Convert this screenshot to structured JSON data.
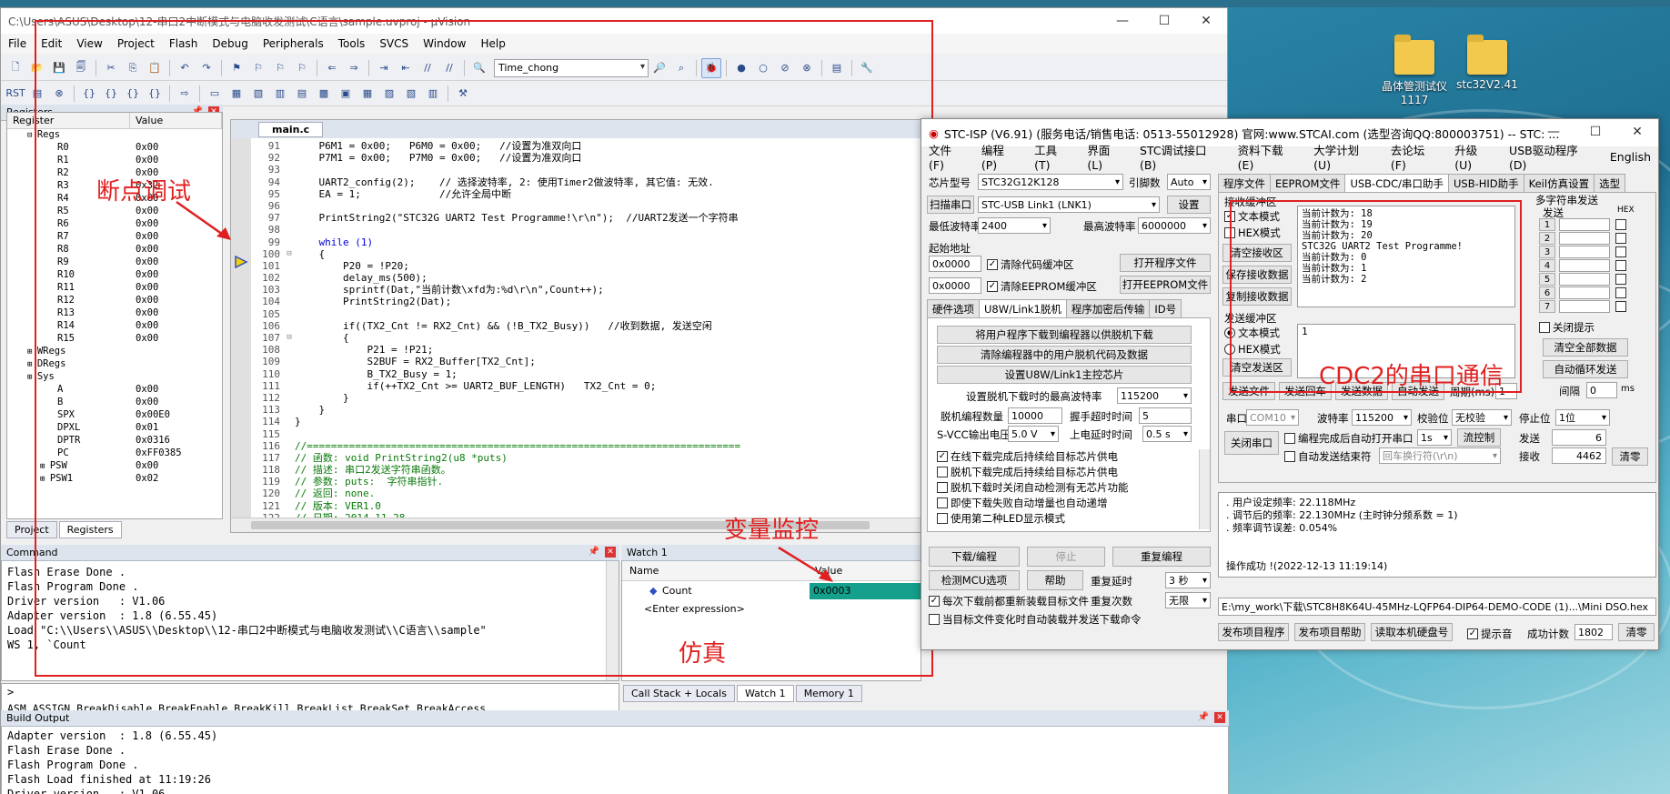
{
  "keil": {
    "title": "C:\\Users\\ASUS\\Desktop\\12-串口2中断模式与电脑收发测试\\C语言\\sample.uvproj - µVision",
    "menu": [
      "File",
      "Edit",
      "View",
      "Project",
      "Flash",
      "Debug",
      "Peripherals",
      "Tools",
      "SVCS",
      "Window",
      "Help"
    ],
    "target_combo": "Time_chong",
    "registers": {
      "title": "Registers",
      "col_register": "Register",
      "col_value": "Value",
      "rows": [
        {
          "name": "Regs",
          "value": "",
          "group": true
        },
        {
          "name": "R0",
          "value": "0x00"
        },
        {
          "name": "R1",
          "value": "0x00"
        },
        {
          "name": "R2",
          "value": "0x00"
        },
        {
          "name": "R3",
          "value": "0x32"
        },
        {
          "name": "R4",
          "value": "0x00"
        },
        {
          "name": "R5",
          "value": "0x00"
        },
        {
          "name": "R6",
          "value": "0x00"
        },
        {
          "name": "R7",
          "value": "0x00"
        },
        {
          "name": "R8",
          "value": "0x00"
        },
        {
          "name": "R9",
          "value": "0x00"
        },
        {
          "name": "R10",
          "value": "0x00"
        },
        {
          "name": "R11",
          "value": "0x00"
        },
        {
          "name": "R12",
          "value": "0x00"
        },
        {
          "name": "R13",
          "value": "0x00"
        },
        {
          "name": "R14",
          "value": "0x00"
        },
        {
          "name": "R15",
          "value": "0x00"
        },
        {
          "name": "WRegs",
          "value": "",
          "group": true
        },
        {
          "name": "DRegs",
          "value": "",
          "group": true
        },
        {
          "name": "Sys",
          "value": "",
          "group": true
        },
        {
          "name": "A",
          "value": "0x00"
        },
        {
          "name": "B",
          "value": "0x00"
        },
        {
          "name": "SPX",
          "value": "0x00E0"
        },
        {
          "name": "DPXL",
          "value": "0x01"
        },
        {
          "name": "DPTR",
          "value": "0x0316"
        },
        {
          "name": "PC",
          "value": "0xFF0385"
        },
        {
          "name": "PSW",
          "value": "0x00",
          "sub": true
        },
        {
          "name": "PSW1",
          "value": "0x02",
          "sub": true
        }
      ],
      "tabs": [
        "Project",
        "Registers"
      ]
    },
    "editor": {
      "tab": "main.c",
      "lines": [
        {
          "no": "91",
          "text": "    P6M1 = 0x00;   P6M0 = 0x00;   //设置为准双向口",
          "cls": "code"
        },
        {
          "no": "92",
          "text": "    P7M1 = 0x00;   P7M0 = 0x00;   //设置为准双向口",
          "cls": "code"
        },
        {
          "no": "93",
          "text": "",
          "cls": "code"
        },
        {
          "no": "94",
          "text": "    UART2_config(2);    // 选择波特率, 2: 使用Timer2做波特率, 其它值: 无效.",
          "cls": "code"
        },
        {
          "no": "95",
          "text": "    EA = 1;             //允许全局中断",
          "cls": "code"
        },
        {
          "no": "96",
          "text": "",
          "cls": "code"
        },
        {
          "no": "97",
          "text": "    PrintString2(\"STC32G UART2 Test Programme!\\r\\n\");  //UART2发送一个字符串",
          "cls": "code"
        },
        {
          "no": "98",
          "text": "",
          "cls": "code"
        },
        {
          "no": "99",
          "text": "    while (1)",
          "cls": "code kw"
        },
        {
          "no": "100",
          "text": "    {",
          "cls": "code"
        },
        {
          "no": "101",
          "text": "        P20 = !P20;",
          "cls": "code"
        },
        {
          "no": "102",
          "text": "        delay_ms(500);",
          "cls": "code"
        },
        {
          "no": "103",
          "text": "        sprintf(Dat,\"当前计数\\xfd为:%d\\r\\n\",Count++);",
          "cls": "code"
        },
        {
          "no": "104",
          "text": "        PrintString2(Dat);",
          "cls": "code"
        },
        {
          "no": "105",
          "text": "",
          "cls": "code"
        },
        {
          "no": "106",
          "text": "        if((TX2_Cnt != RX2_Cnt) && (!B_TX2_Busy))   //收到数据, 发送空闲",
          "cls": "code"
        },
        {
          "no": "107",
          "text": "        {",
          "cls": "code"
        },
        {
          "no": "108",
          "text": "            P21 = !P21;",
          "cls": "code"
        },
        {
          "no": "109",
          "text": "            S2BUF = RX2_Buffer[TX2_Cnt];",
          "cls": "code"
        },
        {
          "no": "110",
          "text": "            B_TX2_Busy = 1;",
          "cls": "code"
        },
        {
          "no": "111",
          "text": "            if(++TX2_Cnt >= UART2_BUF_LENGTH)   TX2_Cnt = 0;",
          "cls": "code"
        },
        {
          "no": "112",
          "text": "        }",
          "cls": "code"
        },
        {
          "no": "113",
          "text": "    }",
          "cls": "code"
        },
        {
          "no": "114",
          "text": "}",
          "cls": "code"
        },
        {
          "no": "115",
          "text": "",
          "cls": "code"
        },
        {
          "no": "116",
          "text": "//========================================================================",
          "cls": "code cm"
        },
        {
          "no": "117",
          "text": "// 函数: void PrintString2(u8 *puts)",
          "cls": "code cm"
        },
        {
          "no": "118",
          "text": "// 描述: 串口2发送字符串函数。",
          "cls": "code cm"
        },
        {
          "no": "119",
          "text": "// 参数: puts:  字符串指针.",
          "cls": "code cm"
        },
        {
          "no": "120",
          "text": "// 返回: none.",
          "cls": "code cm"
        },
        {
          "no": "121",
          "text": "// 版本: VER1.0",
          "cls": "code cm"
        },
        {
          "no": "122",
          "text": "// 日期: 2014-11-28",
          "cls": "code cm"
        }
      ]
    },
    "command": {
      "title": "Command",
      "lines": [
        "Flash Erase Done .",
        "Flash Program Done .",
        "Driver version   : V1.06",
        "Adapter version  : 1.8 (6.55.45)",
        "Load \"C:\\\\Users\\\\ASUS\\\\Desktop\\\\12-串口2中断模式与电脑收发测试\\\\C语言\\\\sample\"",
        "WS 1, `Count"
      ],
      "prompt": ">",
      "help": "ASM ASSIGN BreakDisable BreakEnable BreakKill BreakList BreakSet BreakAccess"
    },
    "watch": {
      "title": "Watch 1",
      "col_name": "Name",
      "col_value": "Value",
      "var_name": "Count",
      "var_value": "0x0003",
      "enter_expr": "<Enter expression>",
      "tabs": [
        "Call Stack + Locals",
        "Watch 1",
        "Memory 1"
      ]
    },
    "build": {
      "title": "Build Output",
      "lines": [
        "Adapter version  : 1.8 (6.55.45)",
        "Flash Erase Done .",
        "Flash Program Done .",
        "Flash Load finished at 11:19:26",
        "Driver version   : V1.06"
      ]
    }
  },
  "annotations": {
    "breakpoint": "断点调试",
    "watch": "变量监控",
    "simulate": "仿真",
    "cdc": "CDC2的串口通信",
    "color": "#e02020"
  },
  "desktop_icons": [
    {
      "label": "晶体管测试仪\n1117"
    },
    {
      "label": "stc32V2.41"
    }
  ],
  "stc": {
    "title": "STC-ISP (V6.91) (服务电话/销售电话: 0513-55012928) 官网:www.STCAI.com (选型咨询QQ:800003751) -- STC: ...",
    "menu": [
      "文件(F)",
      "编程(P)",
      "工具(T)",
      "界面(L)",
      "STC调试接口(B)",
      "资料下载(E)",
      "大学计划(U)",
      "去论坛(F)",
      "升级(U)",
      "USB驱动程序(D)",
      "English"
    ],
    "chip_label": "芯片型号",
    "chip": "STC32G12K128",
    "pin_label": "引脚数",
    "pin": "Auto",
    "scan_btn": "扫描串口",
    "port": "STC-USB Link1 (LNK1)",
    "settings_btn": "设置",
    "min_baud_label": "最低波特率",
    "min_baud": "2400",
    "max_baud_label": "最高波特率",
    "max_baud": "6000000",
    "start_addr_label": "起始地址",
    "addr1": "0x0000",
    "addr2": "0x0000",
    "clear_code": "清除代码缓冲区",
    "clear_eeprom": "清除EEPROM缓冲区",
    "open_prog": "打开程序文件",
    "open_eeprom": "打开EEPROM文件",
    "left_tabs": [
      "硬件选项",
      "U8W/Link1脱机",
      "程序加密后传输",
      "ID号"
    ],
    "offline_btns": [
      "将用户程序下载到编程器以供脱机下载",
      "清除编程器中的用户脱机代码及数据",
      "设置U8W/Link1主控芯片"
    ],
    "offline_baud_label": "设置脱机下载时的最高波特率",
    "offline_baud": "115200",
    "offline_count_label": "脱机编程数量",
    "offline_count": "10000",
    "handshake_label": "握手超时时间",
    "handshake": "5",
    "svcc_label": "S-VCC输出电压",
    "svcc": "5.0 V",
    "delay_label": "上电延时时间",
    "delay": "0.5 s",
    "offline_opts": [
      {
        "label": "在线下载完成后持续给目标芯片供电",
        "checked": true
      },
      {
        "label": "脱机下载完成后持续给目标芯片供电",
        "checked": false
      },
      {
        "label": "脱机下载时关闭自动检测有无芯片功能",
        "checked": false
      },
      {
        "label": "即使下载失败自动增量也自动递增",
        "checked": false
      },
      {
        "label": "使用第二种LED显示模式",
        "checked": false
      }
    ],
    "dl_btn": "下载/编程",
    "stop_btn": "停止",
    "reprog_btn": "重复编程",
    "mcu_opt_btn": "检测MCU选项",
    "help_btn": "帮助",
    "repeat_delay_label": "重复延时",
    "repeat_delay": "3 秒",
    "repeat_count_label": "重复次数",
    "repeat_count": "无限",
    "reload_chk": "每次下载前都重新装载目标文件",
    "autosend_chk": "当目标文件变化时自动装载并发送下载命令",
    "right_tabs": [
      "程序文件",
      "EEPROM文件",
      "USB-CDC/串口助手",
      "USB-HID助手",
      "Keil仿真设置",
      "选型"
    ],
    "recv_label": "接收缓冲区",
    "text_mode": "文本模式",
    "hex_mode": "HEX模式",
    "clear_recv": "清空接收区",
    "save_recv": "保存接收数据",
    "copy_recv": "复制接收数据",
    "recv_text": "当前计数为: 18\n当前计数为: 19\n当前计数为: 20\nSTC32G UART2 Test Programme!\n当前计数为: 0\n当前计数为: 1\n当前计数为: 2",
    "send_label": "发送缓冲区",
    "send_text": "1",
    "clear_send": "清空发送区",
    "multi_label": "多字符串发送",
    "multi_send": "发送",
    "multi_hex": "HEX",
    "multi_rows": [
      "1",
      "2",
      "3",
      "4",
      "5",
      "6",
      "7"
    ],
    "close_prompt": "关闭提示",
    "clear_all": "清空全部数据",
    "auto_loop": "自动循环发送",
    "interval_label": "间隔",
    "interval": "0",
    "interval_unit": "ms",
    "send_file": "发送文件",
    "send_enter": "发送回车",
    "send_data": "发送数据",
    "auto_send": "自动发送",
    "period_label": "周期(ms)",
    "period": "1",
    "com_label": "串口",
    "com": "COM10",
    "baud_label": "波特率",
    "baud": "115200",
    "parity_label": "校验位",
    "parity": "无校验",
    "stop_label": "停止位",
    "stop": "1位",
    "close_port": "关闭串口",
    "auto_open": "编程完成后自动打开串口",
    "auto_open_val": "1s",
    "flow": "流控制",
    "auto_end": "自动发送结束符",
    "end_char": "回车换行符(\\r\\n)",
    "tx_label": "发送",
    "tx": "6",
    "rx_label": "接收",
    "rx": "4462",
    "clear_count": "清零",
    "info_text": ". 用户设定频率: 22.118MHz\n. 调节后的频率: 22.130MHz (主时钟分频系数 = 1)\n. 频率调节误差: 0.054%\n\n\n操作成功 !(2022-12-13 11:19:14)",
    "hex_path": "E:\\my_work\\下载\\STC8H8K64U-45MHz-LQFP64-DIP64-DEMO-CODE (1)...\\Mini DSO.hex",
    "publish_prog": "发布项目程序",
    "publish_help": "发布项目帮助",
    "read_serial": "读取本机硬盘号",
    "beep": "提示音",
    "success_label": "成功计数",
    "success": "1802",
    "clear_success": "清零"
  }
}
